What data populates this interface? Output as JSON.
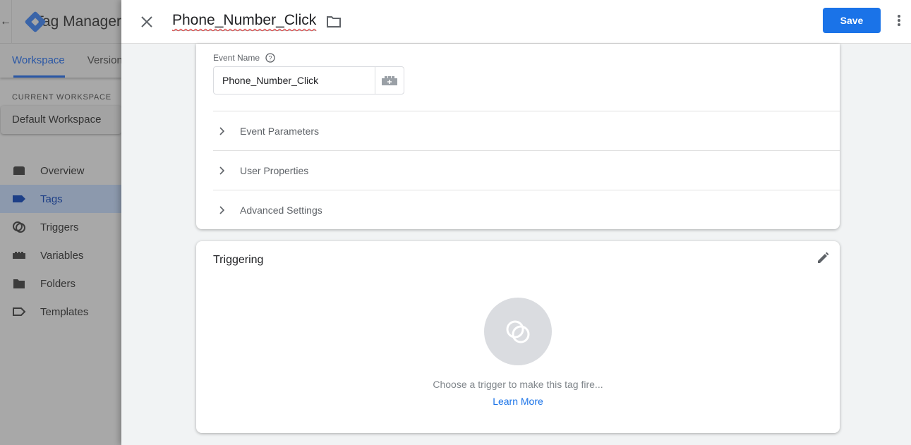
{
  "background": {
    "app_title": "Tag Manager",
    "tabs": [
      {
        "label": "Workspace",
        "active": true
      },
      {
        "label": "Versions",
        "active": false
      }
    ],
    "current_workspace_label": "CURRENT WORKSPACE",
    "workspace_name": "Default Workspace",
    "nav": [
      {
        "label": "Overview",
        "icon": "overview-icon"
      },
      {
        "label": "Tags",
        "icon": "tag-icon",
        "active": true
      },
      {
        "label": "Triggers",
        "icon": "trigger-icon"
      },
      {
        "label": "Variables",
        "icon": "variable-icon"
      },
      {
        "label": "Folders",
        "icon": "folder-icon"
      },
      {
        "label": "Templates",
        "icon": "template-icon"
      }
    ]
  },
  "header": {
    "tag_name": "Phone_Number_Click",
    "save_label": "Save"
  },
  "config": {
    "event_name_label": "Event Name",
    "event_name_value": "Phone_Number_Click",
    "sections": [
      "Event Parameters",
      "User Properties",
      "Advanced Settings"
    ]
  },
  "triggering": {
    "title": "Triggering",
    "hint": "Choose a trigger to make this tag fire...",
    "learn_more": "Learn More"
  },
  "colors": {
    "accent": "#1a73e8",
    "panel_bg": "#f1f3f4"
  }
}
